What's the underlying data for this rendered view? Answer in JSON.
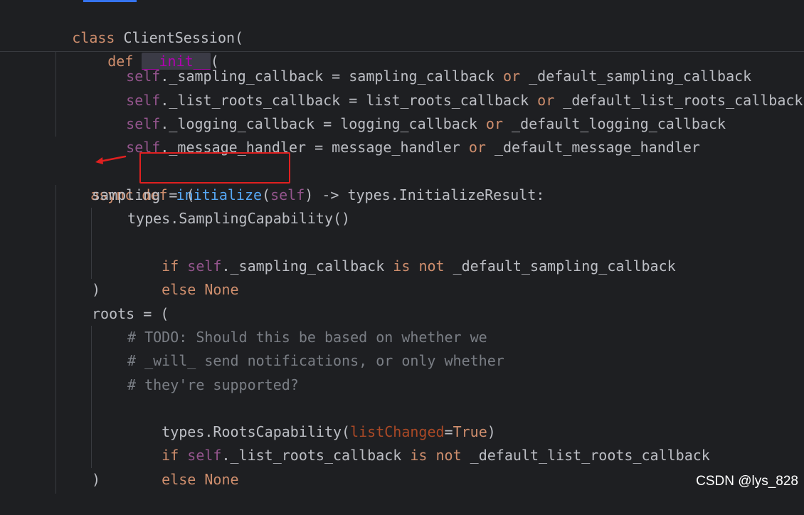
{
  "watermark": "CSDN @lys_828",
  "sticky_header": {
    "line1": {
      "kw": "class",
      "name": " ClientSession("
    },
    "line2": {
      "kw": "def",
      "sp": " ",
      "dunder": "__init__",
      "paren": "("
    }
  },
  "code": {
    "l1": {
      "self": "self",
      "rest": "._sampling_callback = sampling_callback ",
      "kw": "or",
      "tail": " _default_sampling_callback"
    },
    "l2": {
      "self": "self",
      "rest": "._list_roots_callback = list_roots_callback ",
      "kw": "or",
      "tail": " _default_list_roots_callback"
    },
    "l3": {
      "self": "self",
      "rest": "._logging_callback = logging_callback ",
      "kw": "or",
      "tail": " _default_logging_callback"
    },
    "l4": {
      "self": "self",
      "rest": "._message_handler = message_handler ",
      "kw": "or",
      "tail": " _default_message_handler"
    },
    "l5": {
      "async": "async",
      "def": " def ",
      "fn": "initialize",
      "open": "(",
      "self": "self",
      "close": ")",
      "tail": " -> types.InitializeResult:"
    },
    "l6": "sampling = (",
    "l7": "types.SamplingCapability()",
    "l8": {
      "if": "if ",
      "self": "self",
      "rest": "._sampling_callback ",
      "is": "is",
      "sp": " ",
      "not": "not",
      "tail": " _default_sampling_callback"
    },
    "l9": {
      "else": "else ",
      "none": "None"
    },
    "l10": ")",
    "l11": "roots = (",
    "l12": "# TODO: Should this be based on whether we",
    "l13": "# _will_ send notifications, or only whether",
    "l14": "# they're supported?",
    "l15": {
      "head": "types.RootsCapability(",
      "param": "listChanged",
      "eq": "=",
      "true": "True",
      "close": ")"
    },
    "l16": {
      "if": "if ",
      "self": "self",
      "rest": "._list_roots_callback ",
      "is": "is",
      "sp": " ",
      "not": "not",
      "tail": " _default_list_roots_callback"
    },
    "l17": {
      "else": "else ",
      "none": "None"
    },
    "l18": ")"
  }
}
